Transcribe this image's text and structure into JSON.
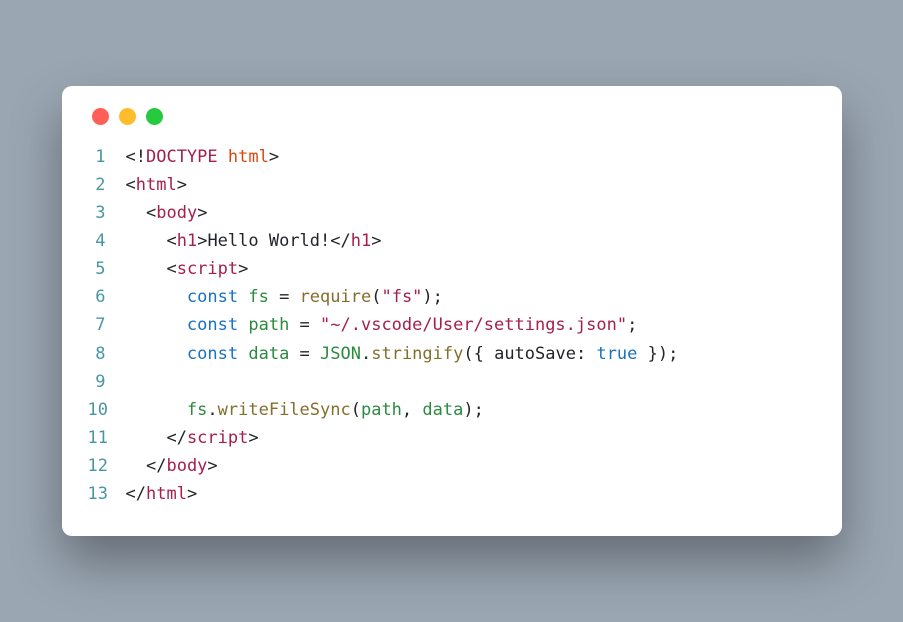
{
  "window": {
    "traffic_light_colors": [
      "#ff5f56",
      "#ffbd2e",
      "#27c93f"
    ]
  },
  "code": {
    "lines": [
      {
        "n": "1",
        "indent": "",
        "tokens": [
          {
            "c": "tok-punc",
            "t": "<!"
          },
          {
            "c": "tok-doctype",
            "t": "DOCTYPE"
          },
          {
            "c": "tok-punc",
            "t": " "
          },
          {
            "c": "tok-attr",
            "t": "html"
          },
          {
            "c": "tok-punc",
            "t": ">"
          }
        ]
      },
      {
        "n": "2",
        "indent": "",
        "tokens": [
          {
            "c": "tok-punc",
            "t": "<"
          },
          {
            "c": "tok-tag",
            "t": "html"
          },
          {
            "c": "tok-punc",
            "t": ">"
          }
        ]
      },
      {
        "n": "3",
        "indent": "  ",
        "tokens": [
          {
            "c": "tok-punc",
            "t": "<"
          },
          {
            "c": "tok-tag",
            "t": "body"
          },
          {
            "c": "tok-punc",
            "t": ">"
          }
        ]
      },
      {
        "n": "4",
        "indent": "    ",
        "tokens": [
          {
            "c": "tok-punc",
            "t": "<"
          },
          {
            "c": "tok-tag",
            "t": "h1"
          },
          {
            "c": "tok-punc",
            "t": ">"
          },
          {
            "c": "tok-text",
            "t": "Hello World!"
          },
          {
            "c": "tok-punc",
            "t": "</"
          },
          {
            "c": "tok-tag",
            "t": "h1"
          },
          {
            "c": "tok-punc",
            "t": ">"
          }
        ]
      },
      {
        "n": "5",
        "indent": "    ",
        "tokens": [
          {
            "c": "tok-punc",
            "t": "<"
          },
          {
            "c": "tok-tag",
            "t": "script"
          },
          {
            "c": "tok-punc",
            "t": ">"
          }
        ]
      },
      {
        "n": "6",
        "indent": "      ",
        "tokens": [
          {
            "c": "tok-key",
            "t": "const"
          },
          {
            "c": "tok-punc",
            "t": " "
          },
          {
            "c": "tok-ident",
            "t": "fs"
          },
          {
            "c": "tok-punc",
            "t": " = "
          },
          {
            "c": "tok-func",
            "t": "require"
          },
          {
            "c": "tok-punc",
            "t": "("
          },
          {
            "c": "tok-str",
            "t": "\"fs\""
          },
          {
            "c": "tok-punc",
            "t": ");"
          }
        ]
      },
      {
        "n": "7",
        "indent": "      ",
        "tokens": [
          {
            "c": "tok-key",
            "t": "const"
          },
          {
            "c": "tok-punc",
            "t": " "
          },
          {
            "c": "tok-ident",
            "t": "path"
          },
          {
            "c": "tok-punc",
            "t": " = "
          },
          {
            "c": "tok-str",
            "t": "\"~/.vscode/User/settings.json\""
          },
          {
            "c": "tok-punc",
            "t": ";"
          }
        ]
      },
      {
        "n": "8",
        "indent": "      ",
        "tokens": [
          {
            "c": "tok-key",
            "t": "const"
          },
          {
            "c": "tok-punc",
            "t": " "
          },
          {
            "c": "tok-ident",
            "t": "data"
          },
          {
            "c": "tok-punc",
            "t": " = "
          },
          {
            "c": "tok-ident",
            "t": "JSON"
          },
          {
            "c": "tok-punc",
            "t": "."
          },
          {
            "c": "tok-func",
            "t": "stringify"
          },
          {
            "c": "tok-punc",
            "t": "({ "
          },
          {
            "c": "tok-prop",
            "t": "autoSave"
          },
          {
            "c": "tok-punc",
            "t": ": "
          },
          {
            "c": "tok-bool",
            "t": "true"
          },
          {
            "c": "tok-punc",
            "t": " });"
          }
        ]
      },
      {
        "n": "9",
        "indent": "",
        "tokens": []
      },
      {
        "n": "10",
        "indent": "      ",
        "tokens": [
          {
            "c": "tok-ident",
            "t": "fs"
          },
          {
            "c": "tok-punc",
            "t": "."
          },
          {
            "c": "tok-func",
            "t": "writeFileSync"
          },
          {
            "c": "tok-punc",
            "t": "("
          },
          {
            "c": "tok-ident",
            "t": "path"
          },
          {
            "c": "tok-punc",
            "t": ", "
          },
          {
            "c": "tok-ident",
            "t": "data"
          },
          {
            "c": "tok-punc",
            "t": ");"
          }
        ]
      },
      {
        "n": "11",
        "indent": "    ",
        "tokens": [
          {
            "c": "tok-punc",
            "t": "</"
          },
          {
            "c": "tok-tag",
            "t": "script"
          },
          {
            "c": "tok-punc",
            "t": ">"
          }
        ]
      },
      {
        "n": "12",
        "indent": "  ",
        "tokens": [
          {
            "c": "tok-punc",
            "t": "</"
          },
          {
            "c": "tok-tag",
            "t": "body"
          },
          {
            "c": "tok-punc",
            "t": ">"
          }
        ]
      },
      {
        "n": "13",
        "indent": "",
        "tokens": [
          {
            "c": "tok-punc",
            "t": "</"
          },
          {
            "c": "tok-tag",
            "t": "html"
          },
          {
            "c": "tok-punc",
            "t": ">"
          }
        ]
      }
    ]
  }
}
